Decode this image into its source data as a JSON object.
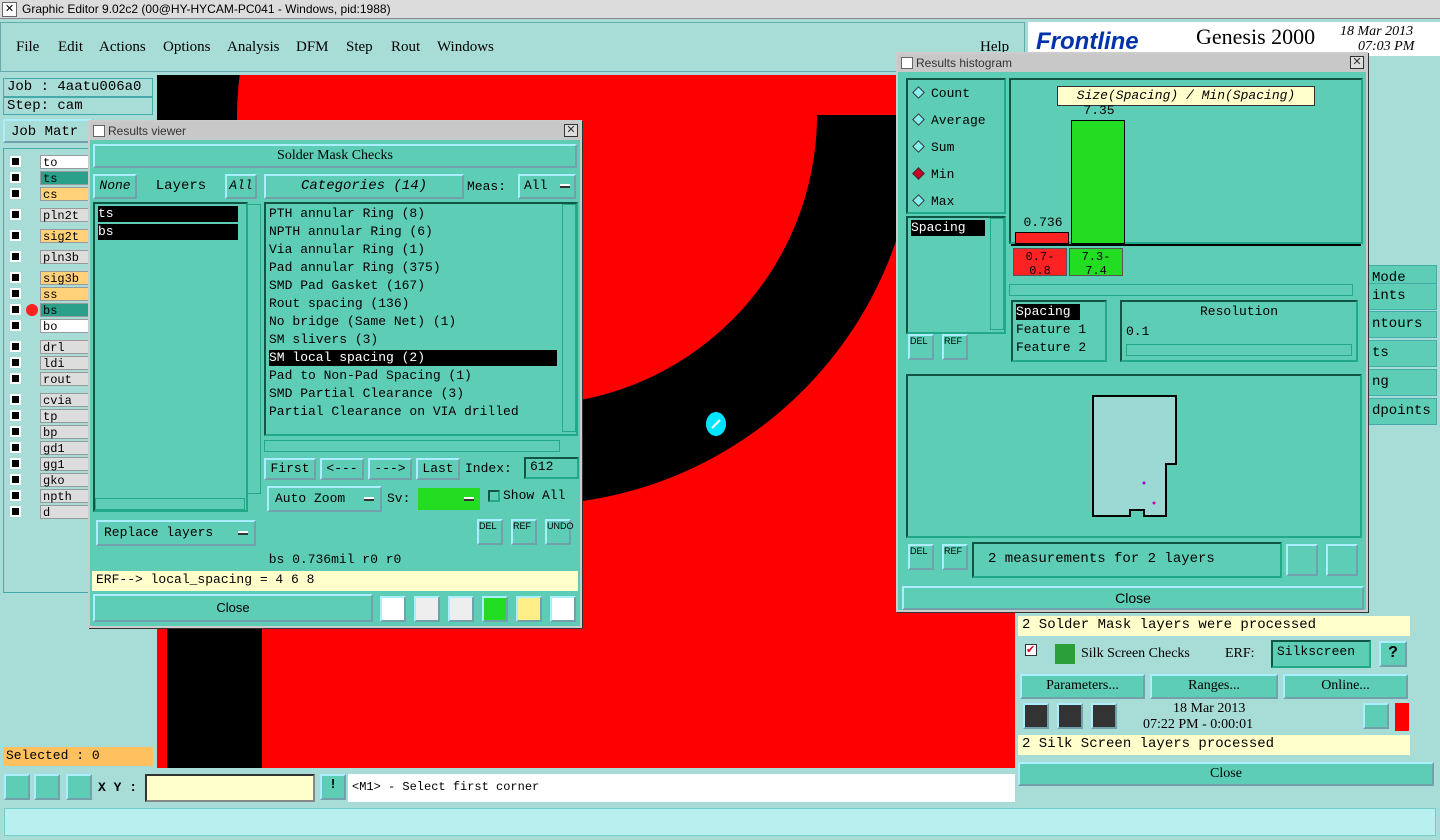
{
  "app": {
    "title": "Graphic Editor 9.02c2 (00@HY-HYCAM-PC041 - Windows, pid:1988)"
  },
  "menu": {
    "items": [
      "File",
      "Edit",
      "Actions",
      "Options",
      "Analysis",
      "DFM",
      "Step",
      "Rout",
      "Windows"
    ],
    "help": "Help"
  },
  "header": {
    "brand": "Frontline",
    "product": "Genesis 2000",
    "date": "18 Mar 2013",
    "time": "07:03 PM"
  },
  "left": {
    "job": "Job : 4aatu006a0",
    "step": "Step: cam",
    "job_matrix": "Job Matr",
    "layers": [
      {
        "name": "to",
        "color": "#ffffff"
      },
      {
        "name": "ts",
        "color": "#2a9f8a"
      },
      {
        "name": "cs",
        "color": "#ffd27a"
      },
      {
        "name": "pln2t",
        "color": "#dddddd"
      },
      {
        "name": "sig2t",
        "color": "#ffd27a"
      },
      {
        "name": "pln3b",
        "color": "#dddddd"
      },
      {
        "name": "sig3b",
        "color": "#ffd27a"
      },
      {
        "name": "ss",
        "color": "#ffd27a"
      },
      {
        "name": "bs",
        "color": "#2a9f8a"
      },
      {
        "name": "bo",
        "color": "#ffffff"
      },
      {
        "name": "drl",
        "color": "#dddddd"
      },
      {
        "name": "ldi",
        "color": "#dddddd"
      },
      {
        "name": "rout",
        "color": "#dddddd"
      },
      {
        "name": "cvia",
        "color": "#dddddd"
      },
      {
        "name": "tp",
        "color": "#dddddd"
      },
      {
        "name": "bp",
        "color": "#dddddd"
      },
      {
        "name": "gd1",
        "color": "#dddddd"
      },
      {
        "name": "gg1",
        "color": "#dddddd"
      },
      {
        "name": "gko",
        "color": "#dddddd"
      },
      {
        "name": "npth",
        "color": "#dddddd"
      },
      {
        "name": "d",
        "color": "#dddddd"
      }
    ],
    "selected": "Selected : 0"
  },
  "results_viewer": {
    "title": "Results viewer",
    "heading": "Solder Mask Checks",
    "none": "None",
    "layers_label": "Layers",
    "all": "All",
    "categories": "Categories (14)",
    "meas_label": "Meas:",
    "meas_value": "All",
    "layer_list": [
      "ts",
      "bs"
    ],
    "category_list": [
      "PTH annular Ring (8)",
      "NPTH annular Ring (6)",
      "Via annular Ring (1)",
      "Pad annular Ring (375)",
      "SMD Pad Gasket (167)",
      "Rout spacing (136)",
      "No bridge (Same Net) (1)",
      "SM slivers (3)",
      "SM local spacing (2)",
      "Pad to Non-Pad Spacing (1)",
      "SMD Partial Clearance (3)",
      "Partial Clearance on VIA drilled"
    ],
    "selected_category": "SM local spacing (2)",
    "first": "First",
    "prev": "<---",
    "next": "--->",
    "last": "Last",
    "index_label": "Index:",
    "index_value": "612",
    "auto_zoom": "Auto Zoom",
    "sv": "Sv:",
    "show_all": "Show All",
    "replace_layers": "Replace layers",
    "status": "bs 0.736mil  r0  r0",
    "erf": "ERF--> local_spacing = 4 6 8",
    "close": "Close",
    "del": "DEL",
    "ref": "REF",
    "undo": "UNDO"
  },
  "histogram": {
    "title": "Results histogram",
    "modes": [
      "Count",
      "Average",
      "Sum",
      "Min",
      "Max"
    ],
    "selected_mode": "Min",
    "chart_title": "Size(Spacing) / Min(Spacing)",
    "bars": [
      {
        "range": "0.7-0.8",
        "value": "0.736",
        "color": "#ff2222"
      },
      {
        "range": "7.3-7.4",
        "value": "7.35",
        "color": "#22dd22"
      }
    ],
    "attr_list": [
      "Spacing"
    ],
    "features": [
      "Spacing",
      "Feature 1",
      "Feature 2"
    ],
    "resolution_label": "Resolution",
    "resolution_value": "0.1",
    "measurements": "2 measurements for 2 layers",
    "close": "Close",
    "del": "DEL",
    "ref": "REF"
  },
  "checklist": {
    "solder_msg": "2 Solder Mask layers were processed",
    "silk_label": "Silk Screen Checks",
    "erf_label": "ERF:",
    "erf_value": "Silkscreen",
    "parameters": "Parameters...",
    "ranges": "Ranges...",
    "online": "Online...",
    "date": "18 Mar 2013",
    "time": "07:22 PM - 0:00:01",
    "silk_msg": "2 Silk Screen layers processed",
    "close": "Close",
    "right_items": [
      "Mode",
      "ints",
      "ntours",
      "ts",
      "ng",
      "dpoints"
    ]
  },
  "bottom": {
    "xy_label": "X Y :",
    "prompt": "<M1> - Select first corner"
  }
}
